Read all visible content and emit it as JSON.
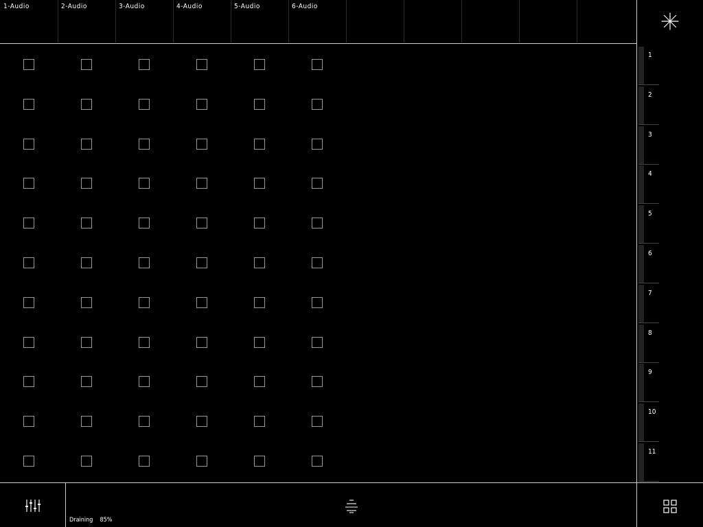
{
  "tracks": [
    {
      "name": "1-Audio"
    },
    {
      "name": "2-Audio"
    },
    {
      "name": "3-Audio"
    },
    {
      "name": "4-Audio"
    },
    {
      "name": "5-Audio"
    },
    {
      "name": "6-Audio"
    },
    {
      "name": ""
    },
    {
      "name": ""
    },
    {
      "name": ""
    },
    {
      "name": ""
    },
    {
      "name": ""
    }
  ],
  "scenes": [
    "1",
    "2",
    "3",
    "4",
    "5",
    "6",
    "7",
    "8",
    "9",
    "10",
    "11"
  ],
  "status": {
    "label": "Draining",
    "value": "85%"
  },
  "icons": {
    "top_right": "sparkle-icon",
    "bottom_left": "mixer-sliders-icon",
    "bottom_center": "lines-menu-icon",
    "bottom_right": "grid-view-icon"
  },
  "colors": {
    "background": "#000000",
    "foreground": "#ffffff",
    "slot_border": "#9a9a9a"
  }
}
